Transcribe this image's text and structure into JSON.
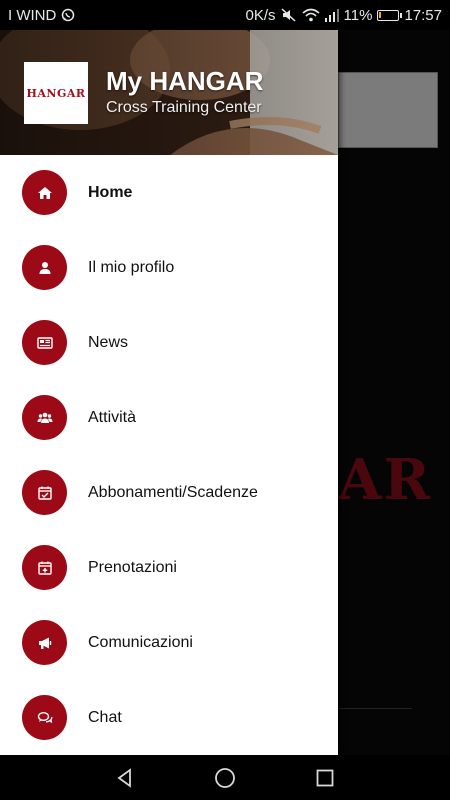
{
  "status_bar": {
    "carrier": "I WIND",
    "speed": "0K/s",
    "battery_percent": "11%",
    "battery_level": 0.11,
    "time": "17:57"
  },
  "drawer": {
    "logo_text": "HANGAR",
    "title": "My HANGAR",
    "subtitle": "Cross Training Center",
    "menu": [
      {
        "label": "Home",
        "icon": "home-icon",
        "active": true
      },
      {
        "label": "Il mio profilo",
        "icon": "user-icon",
        "active": false
      },
      {
        "label": "News",
        "icon": "newspaper-icon",
        "active": false
      },
      {
        "label": "Attività",
        "icon": "group-icon",
        "active": false
      },
      {
        "label": "Abbonamenti/Scadenze",
        "icon": "calendar-check-icon",
        "active": false
      },
      {
        "label": "Prenotazioni",
        "icon": "calendar-plus-icon",
        "active": false
      },
      {
        "label": "Comunicazioni",
        "icon": "megaphone-icon",
        "active": false
      },
      {
        "label": "Chat",
        "icon": "chat-bubbles-icon",
        "active": false
      }
    ]
  },
  "background": {
    "brand_fragment": "AR"
  },
  "colors": {
    "accent": "#9b0a16",
    "drawer_bg": "#ffffff",
    "battery_fill": "#f0b400"
  }
}
